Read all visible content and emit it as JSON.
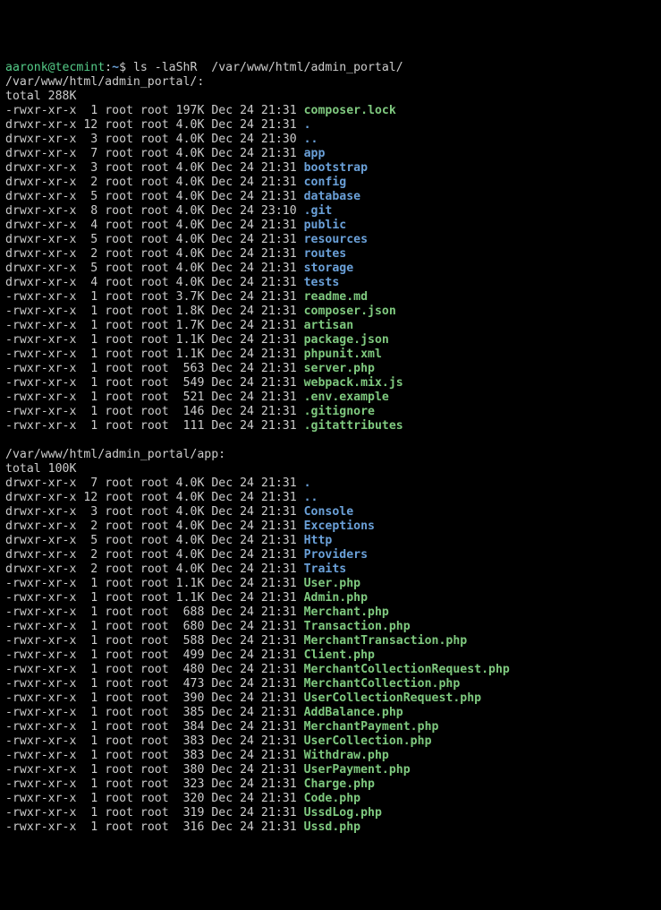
{
  "prompt": {
    "user": "aaronk",
    "at": "@",
    "host": "tecmint",
    "sep": ":",
    "cwd": "~",
    "sigil": "$ ",
    "command": "ls -laShR  /var/www/html/admin_portal/"
  },
  "sections": [
    {
      "path": "/var/www/html/admin_portal/:",
      "total": "total 288K",
      "rows": [
        {
          "perm": "-rwxr-xr-x",
          "links": "1",
          "owner": "root",
          "group": "root",
          "size": "197K",
          "date": "Dec 24 21:31",
          "name": "composer.lock",
          "cls": "exec"
        },
        {
          "perm": "drwxr-xr-x",
          "links": "12",
          "owner": "root",
          "group": "root",
          "size": "4.0K",
          "date": "Dec 24 21:31",
          "name": ".",
          "cls": "dir"
        },
        {
          "perm": "drwxr-xr-x",
          "links": "3",
          "owner": "root",
          "group": "root",
          "size": "4.0K",
          "date": "Dec 24 21:30",
          "name": "..",
          "cls": "dir"
        },
        {
          "perm": "drwxr-xr-x",
          "links": "7",
          "owner": "root",
          "group": "root",
          "size": "4.0K",
          "date": "Dec 24 21:31",
          "name": "app",
          "cls": "dir"
        },
        {
          "perm": "drwxr-xr-x",
          "links": "3",
          "owner": "root",
          "group": "root",
          "size": "4.0K",
          "date": "Dec 24 21:31",
          "name": "bootstrap",
          "cls": "dir"
        },
        {
          "perm": "drwxr-xr-x",
          "links": "2",
          "owner": "root",
          "group": "root",
          "size": "4.0K",
          "date": "Dec 24 21:31",
          "name": "config",
          "cls": "dir"
        },
        {
          "perm": "drwxr-xr-x",
          "links": "5",
          "owner": "root",
          "group": "root",
          "size": "4.0K",
          "date": "Dec 24 21:31",
          "name": "database",
          "cls": "dir"
        },
        {
          "perm": "drwxr-xr-x",
          "links": "8",
          "owner": "root",
          "group": "root",
          "size": "4.0K",
          "date": "Dec 24 23:10",
          "name": ".git",
          "cls": "dir"
        },
        {
          "perm": "drwxr-xr-x",
          "links": "4",
          "owner": "root",
          "group": "root",
          "size": "4.0K",
          "date": "Dec 24 21:31",
          "name": "public",
          "cls": "dir"
        },
        {
          "perm": "drwxr-xr-x",
          "links": "5",
          "owner": "root",
          "group": "root",
          "size": "4.0K",
          "date": "Dec 24 21:31",
          "name": "resources",
          "cls": "dir"
        },
        {
          "perm": "drwxr-xr-x",
          "links": "2",
          "owner": "root",
          "group": "root",
          "size": "4.0K",
          "date": "Dec 24 21:31",
          "name": "routes",
          "cls": "dir"
        },
        {
          "perm": "drwxr-xr-x",
          "links": "5",
          "owner": "root",
          "group": "root",
          "size": "4.0K",
          "date": "Dec 24 21:31",
          "name": "storage",
          "cls": "dir"
        },
        {
          "perm": "drwxr-xr-x",
          "links": "4",
          "owner": "root",
          "group": "root",
          "size": "4.0K",
          "date": "Dec 24 21:31",
          "name": "tests",
          "cls": "dir"
        },
        {
          "perm": "-rwxr-xr-x",
          "links": "1",
          "owner": "root",
          "group": "root",
          "size": "3.7K",
          "date": "Dec 24 21:31",
          "name": "readme.md",
          "cls": "exec"
        },
        {
          "perm": "-rwxr-xr-x",
          "links": "1",
          "owner": "root",
          "group": "root",
          "size": "1.8K",
          "date": "Dec 24 21:31",
          "name": "composer.json",
          "cls": "exec"
        },
        {
          "perm": "-rwxr-xr-x",
          "links": "1",
          "owner": "root",
          "group": "root",
          "size": "1.7K",
          "date": "Dec 24 21:31",
          "name": "artisan",
          "cls": "exec"
        },
        {
          "perm": "-rwxr-xr-x",
          "links": "1",
          "owner": "root",
          "group": "root",
          "size": "1.1K",
          "date": "Dec 24 21:31",
          "name": "package.json",
          "cls": "exec"
        },
        {
          "perm": "-rwxr-xr-x",
          "links": "1",
          "owner": "root",
          "group": "root",
          "size": "1.1K",
          "date": "Dec 24 21:31",
          "name": "phpunit.xml",
          "cls": "exec"
        },
        {
          "perm": "-rwxr-xr-x",
          "links": "1",
          "owner": "root",
          "group": "root",
          "size": "563",
          "date": "Dec 24 21:31",
          "name": "server.php",
          "cls": "exec"
        },
        {
          "perm": "-rwxr-xr-x",
          "links": "1",
          "owner": "root",
          "group": "root",
          "size": "549",
          "date": "Dec 24 21:31",
          "name": "webpack.mix.js",
          "cls": "exec"
        },
        {
          "perm": "-rwxr-xr-x",
          "links": "1",
          "owner": "root",
          "group": "root",
          "size": "521",
          "date": "Dec 24 21:31",
          "name": ".env.example",
          "cls": "exec"
        },
        {
          "perm": "-rwxr-xr-x",
          "links": "1",
          "owner": "root",
          "group": "root",
          "size": "146",
          "date": "Dec 24 21:31",
          "name": ".gitignore",
          "cls": "exec"
        },
        {
          "perm": "-rwxr-xr-x",
          "links": "1",
          "owner": "root",
          "group": "root",
          "size": "111",
          "date": "Dec 24 21:31",
          "name": ".gitattributes",
          "cls": "exec"
        }
      ]
    },
    {
      "path": "/var/www/html/admin_portal/app:",
      "total": "total 100K",
      "rows": [
        {
          "perm": "drwxr-xr-x",
          "links": "7",
          "owner": "root",
          "group": "root",
          "size": "4.0K",
          "date": "Dec 24 21:31",
          "name": ".",
          "cls": "dir"
        },
        {
          "perm": "drwxr-xr-x",
          "links": "12",
          "owner": "root",
          "group": "root",
          "size": "4.0K",
          "date": "Dec 24 21:31",
          "name": "..",
          "cls": "dir"
        },
        {
          "perm": "drwxr-xr-x",
          "links": "3",
          "owner": "root",
          "group": "root",
          "size": "4.0K",
          "date": "Dec 24 21:31",
          "name": "Console",
          "cls": "dir"
        },
        {
          "perm": "drwxr-xr-x",
          "links": "2",
          "owner": "root",
          "group": "root",
          "size": "4.0K",
          "date": "Dec 24 21:31",
          "name": "Exceptions",
          "cls": "dir"
        },
        {
          "perm": "drwxr-xr-x",
          "links": "5",
          "owner": "root",
          "group": "root",
          "size": "4.0K",
          "date": "Dec 24 21:31",
          "name": "Http",
          "cls": "dir"
        },
        {
          "perm": "drwxr-xr-x",
          "links": "2",
          "owner": "root",
          "group": "root",
          "size": "4.0K",
          "date": "Dec 24 21:31",
          "name": "Providers",
          "cls": "dir"
        },
        {
          "perm": "drwxr-xr-x",
          "links": "2",
          "owner": "root",
          "group": "root",
          "size": "4.0K",
          "date": "Dec 24 21:31",
          "name": "Traits",
          "cls": "dir"
        },
        {
          "perm": "-rwxr-xr-x",
          "links": "1",
          "owner": "root",
          "group": "root",
          "size": "1.1K",
          "date": "Dec 24 21:31",
          "name": "User.php",
          "cls": "exec"
        },
        {
          "perm": "-rwxr-xr-x",
          "links": "1",
          "owner": "root",
          "group": "root",
          "size": "1.1K",
          "date": "Dec 24 21:31",
          "name": "Admin.php",
          "cls": "exec"
        },
        {
          "perm": "-rwxr-xr-x",
          "links": "1",
          "owner": "root",
          "group": "root",
          "size": "688",
          "date": "Dec 24 21:31",
          "name": "Merchant.php",
          "cls": "exec"
        },
        {
          "perm": "-rwxr-xr-x",
          "links": "1",
          "owner": "root",
          "group": "root",
          "size": "680",
          "date": "Dec 24 21:31",
          "name": "Transaction.php",
          "cls": "exec"
        },
        {
          "perm": "-rwxr-xr-x",
          "links": "1",
          "owner": "root",
          "group": "root",
          "size": "588",
          "date": "Dec 24 21:31",
          "name": "MerchantTransaction.php",
          "cls": "exec"
        },
        {
          "perm": "-rwxr-xr-x",
          "links": "1",
          "owner": "root",
          "group": "root",
          "size": "499",
          "date": "Dec 24 21:31",
          "name": "Client.php",
          "cls": "exec"
        },
        {
          "perm": "-rwxr-xr-x",
          "links": "1",
          "owner": "root",
          "group": "root",
          "size": "480",
          "date": "Dec 24 21:31",
          "name": "MerchantCollectionRequest.php",
          "cls": "exec"
        },
        {
          "perm": "-rwxr-xr-x",
          "links": "1",
          "owner": "root",
          "group": "root",
          "size": "473",
          "date": "Dec 24 21:31",
          "name": "MerchantCollection.php",
          "cls": "exec"
        },
        {
          "perm": "-rwxr-xr-x",
          "links": "1",
          "owner": "root",
          "group": "root",
          "size": "390",
          "date": "Dec 24 21:31",
          "name": "UserCollectionRequest.php",
          "cls": "exec"
        },
        {
          "perm": "-rwxr-xr-x",
          "links": "1",
          "owner": "root",
          "group": "root",
          "size": "385",
          "date": "Dec 24 21:31",
          "name": "AddBalance.php",
          "cls": "exec"
        },
        {
          "perm": "-rwxr-xr-x",
          "links": "1",
          "owner": "root",
          "group": "root",
          "size": "384",
          "date": "Dec 24 21:31",
          "name": "MerchantPayment.php",
          "cls": "exec"
        },
        {
          "perm": "-rwxr-xr-x",
          "links": "1",
          "owner": "root",
          "group": "root",
          "size": "383",
          "date": "Dec 24 21:31",
          "name": "UserCollection.php",
          "cls": "exec"
        },
        {
          "perm": "-rwxr-xr-x",
          "links": "1",
          "owner": "root",
          "group": "root",
          "size": "383",
          "date": "Dec 24 21:31",
          "name": "Withdraw.php",
          "cls": "exec"
        },
        {
          "perm": "-rwxr-xr-x",
          "links": "1",
          "owner": "root",
          "group": "root",
          "size": "380",
          "date": "Dec 24 21:31",
          "name": "UserPayment.php",
          "cls": "exec"
        },
        {
          "perm": "-rwxr-xr-x",
          "links": "1",
          "owner": "root",
          "group": "root",
          "size": "323",
          "date": "Dec 24 21:31",
          "name": "Charge.php",
          "cls": "exec"
        },
        {
          "perm": "-rwxr-xr-x",
          "links": "1",
          "owner": "root",
          "group": "root",
          "size": "320",
          "date": "Dec 24 21:31",
          "name": "Code.php",
          "cls": "exec"
        },
        {
          "perm": "-rwxr-xr-x",
          "links": "1",
          "owner": "root",
          "group": "root",
          "size": "319",
          "date": "Dec 24 21:31",
          "name": "UssdLog.php",
          "cls": "exec"
        },
        {
          "perm": "-rwxr-xr-x",
          "links": "1",
          "owner": "root",
          "group": "root",
          "size": "316",
          "date": "Dec 24 21:31",
          "name": "Ussd.php",
          "cls": "exec"
        }
      ]
    }
  ]
}
